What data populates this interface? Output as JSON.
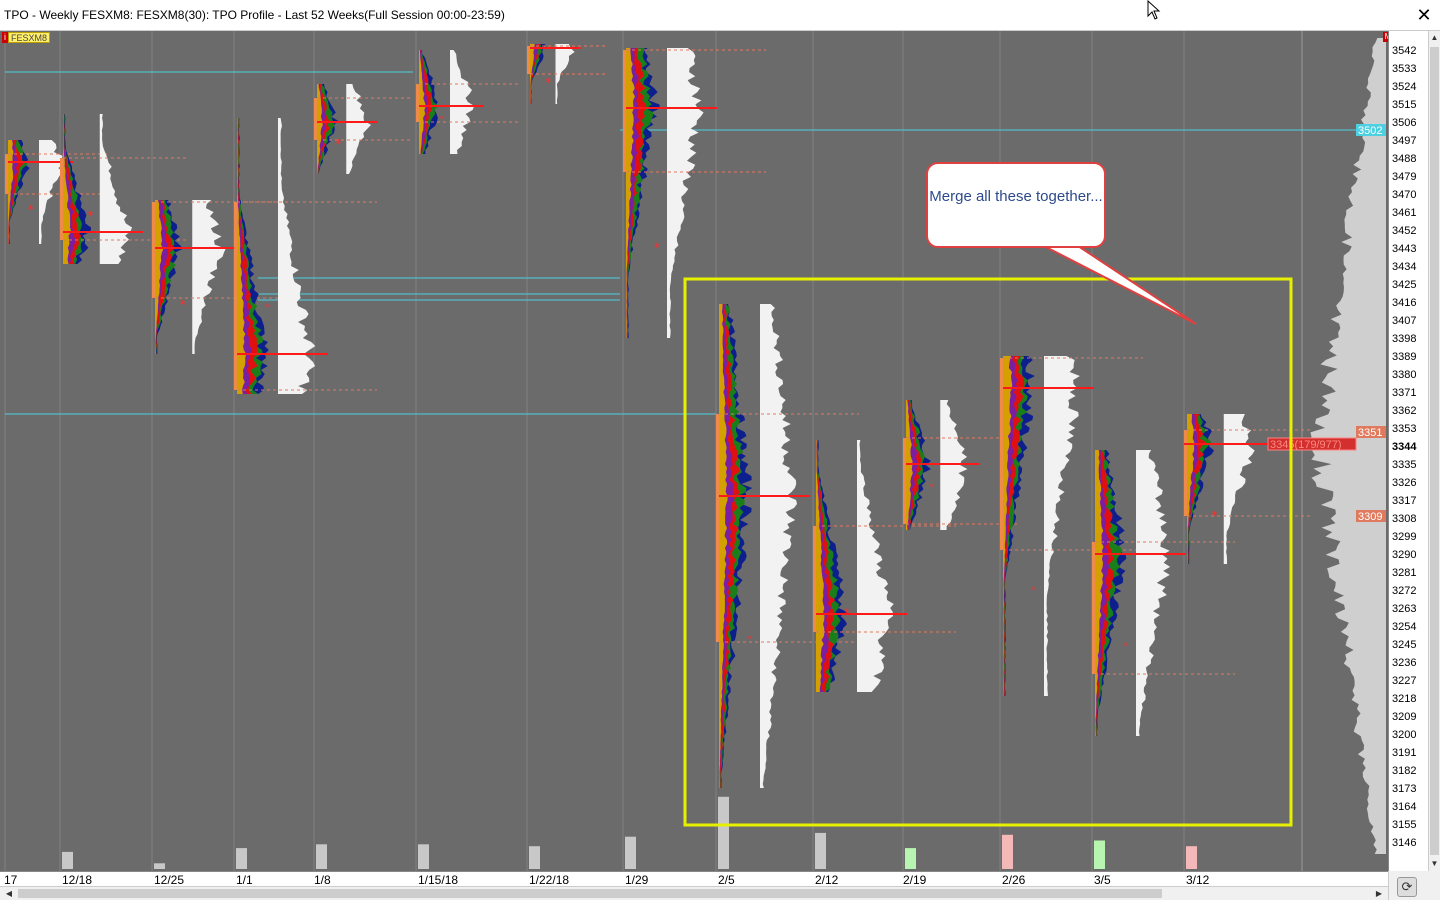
{
  "window": {
    "title": "TPO - Weekly FESXM8: FESXM8(30): TPO Profile - Last 52 Weeks(Full Session 00:00-23:59)",
    "close_glyph": "✕"
  },
  "symbol_tag": {
    "flag": "i",
    "name": "FESXM8"
  },
  "right_flag": "M",
  "callout": {
    "text": "Merge all these together..."
  },
  "price_axis": {
    "labels": [
      "3542",
      "3533",
      "3524",
      "3515",
      "3506",
      "3497",
      "3488",
      "3479",
      "3470",
      "3461",
      "3452",
      "3443",
      "3434",
      "3425",
      "3416",
      "3407",
      "3398",
      "3389",
      "3380",
      "3371",
      "3362",
      "3353",
      "3344",
      "3335",
      "3326",
      "3317",
      "3308",
      "3299",
      "3290",
      "3281",
      "3272",
      "3263",
      "3254",
      "3245",
      "3236",
      "3227",
      "3218",
      "3209",
      "3200",
      "3191",
      "3182",
      "3173",
      "3164",
      "3155",
      "3146"
    ],
    "current_price": "3344",
    "badges": [
      {
        "text": "3502",
        "price": 3502,
        "color": "#4dd0e1"
      },
      {
        "text": "3351",
        "price": 3351,
        "color": "#e07a5f"
      },
      {
        "text": "3309",
        "price": 3309,
        "color": "#e07a5f"
      }
    ],
    "poc_label": "3345(179/977)",
    "poc_price": 3345
  },
  "date_axis": {
    "labels": [
      "17",
      "12/18",
      "12/25",
      "1/1",
      "1/8",
      "1/15/18",
      "1/22/18",
      "1/29",
      "2/5",
      "2/12",
      "2/19",
      "2/26",
      "3/5",
      "3/12"
    ]
  },
  "colors": {
    "background": "#6b6b6b",
    "profile_yellow": "#d4a000",
    "profile_purple": "#7a1fa2",
    "profile_red": "#e01010",
    "profile_green": "#1a7f1a",
    "profile_blue": "#0d1f8c",
    "volume_white": "#f2f2f2",
    "value_area": "#f08a4b",
    "poc_line": "#ff1a1a",
    "level_line": "#4dd0e1",
    "highlight_box": "#e6f000"
  },
  "icons": {
    "close": "close-icon",
    "cursor": "mouse-pointer-icon",
    "refresh": "refresh-icon",
    "scroll_up": "scroll-up-icon",
    "scroll_down": "scroll-down-icon",
    "scroll_left": "scroll-left-icon",
    "scroll_right": "scroll-right-icon"
  },
  "chart_data": {
    "type": "tpo-profile",
    "title": "TPO - Weekly FESXM8: FESXM8(30): TPO Profile - Last 52 Weeks(Full Session 00:00-23:59)",
    "ylim": [
      3140,
      3548
    ],
    "weeks": [
      {
        "label": "17",
        "high": 3497,
        "low": 3445,
        "poc": 3486,
        "vah": 3490,
        "val": 3470,
        "tail": 3445,
        "volume": 0,
        "vol_color": "gray"
      },
      {
        "label": "12/18",
        "high": 3510,
        "low": 3435,
        "poc": 3451,
        "vah": 3488,
        "val": 3447,
        "volume": 9,
        "vol_color": "gray"
      },
      {
        "label": "12/25",
        "high": 3467,
        "low": 3390,
        "poc": 3443,
        "vah": 3466,
        "val": 3418,
        "volume": 3,
        "vol_color": "gray"
      },
      {
        "label": "1/1",
        "high": 3508,
        "low": 3370,
        "poc": 3390,
        "vah": 3466,
        "val": 3372,
        "volume": 11,
        "vol_color": "gray"
      },
      {
        "label": "1/8",
        "high": 3525,
        "low": 3480,
        "poc": 3506,
        "vah": 3518,
        "val": 3497,
        "volume": 13,
        "vol_color": "gray"
      },
      {
        "label": "1/15/18",
        "high": 3542,
        "low": 3490,
        "poc": 3514,
        "vah": 3525,
        "val": 3506,
        "volume": 13,
        "vol_color": "gray"
      },
      {
        "label": "1/22/18",
        "high": 3545,
        "low": 3515,
        "poc": 3543,
        "vah": 3544,
        "val": 3530,
        "volume": 12,
        "vol_color": "gray"
      },
      {
        "label": "1/29",
        "high": 3543,
        "low": 3398,
        "poc": 3513,
        "vah": 3542,
        "val": 3481,
        "volume": 17,
        "vol_color": "gray"
      },
      {
        "label": "2/5",
        "high": 3415,
        "low": 3173,
        "poc": 3319,
        "vah": 3360,
        "val": 3246,
        "volume": 38,
        "vol_color": "gray"
      },
      {
        "label": "2/12",
        "high": 3347,
        "low": 3221,
        "poc": 3260,
        "vah": 3304,
        "val": 3251,
        "volume": 19,
        "vol_color": "gray"
      },
      {
        "label": "2/19",
        "high": 3367,
        "low": 3302,
        "poc": 3335,
        "vah": 3348,
        "val": 3305,
        "volume": 11,
        "vol_color": "green"
      },
      {
        "label": "2/26",
        "high": 3389,
        "low": 3219,
        "poc": 3373,
        "vah": 3388,
        "val": 3292,
        "volume": 18,
        "vol_color": "pink"
      },
      {
        "label": "3/5",
        "high": 3342,
        "low": 3199,
        "poc": 3290,
        "vah": 3296,
        "val": 3230,
        "volume": 15,
        "vol_color": "green"
      },
      {
        "label": "3/12",
        "high": 3360,
        "low": 3285,
        "poc": 3345,
        "vah": 3352,
        "val": 3309,
        "volume": 12,
        "vol_color": "pink"
      }
    ],
    "horizontal_levels": [
      3531,
      3428,
      3420,
      3417,
      3360,
      3502
    ],
    "composite_profile": {
      "high": 3548,
      "low": 3140,
      "poc": 3344
    },
    "grid": true
  }
}
